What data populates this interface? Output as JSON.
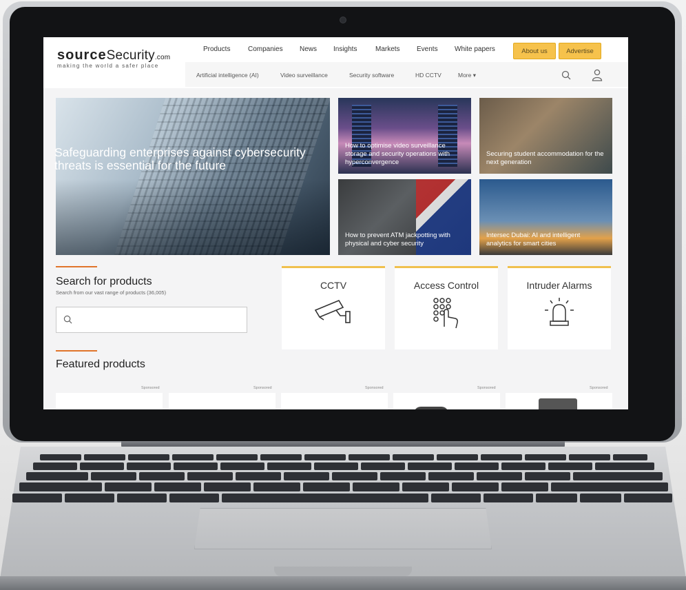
{
  "site": {
    "logo": "sourceSecurity",
    "logo_bold": "source",
    "logo_rest": "Security",
    "logo_suffix": ".com",
    "tagline": "making the world a safer place"
  },
  "nav": {
    "items": [
      "Products",
      "Companies",
      "News",
      "Insights",
      "Markets",
      "Events",
      "White papers"
    ],
    "about_button": "About us",
    "advertise_button": "Advertise"
  },
  "subnav": {
    "items": [
      "Artificial intelligence (AI)",
      "Video surveillance",
      "Security software",
      "HD CCTV"
    ],
    "more": "More ▾"
  },
  "hero": {
    "main_title": "Safeguarding enterprises against cybersecurity threats is essential for the future",
    "cards": [
      "How to optimise video surveillance storage and security operations with hyperconvergence",
      "Securing student accommodation for the next generation",
      "How to prevent ATM jackpotting with physical and cyber security",
      "Intersec Dubai: AI and intelligent analytics for smart cities"
    ]
  },
  "search": {
    "title": "Search for products",
    "subtitle": "Search from our vast range of products (36,005)",
    "placeholder": ""
  },
  "categories": [
    "CCTV",
    "Access Control",
    "Intruder Alarms"
  ],
  "featured": {
    "title": "Featured products",
    "sponsored_label": "Sponsored"
  },
  "colors": {
    "accent_orange": "#e0742a",
    "button_yellow": "#f6c24c",
    "category_border": "#f0c04d"
  }
}
